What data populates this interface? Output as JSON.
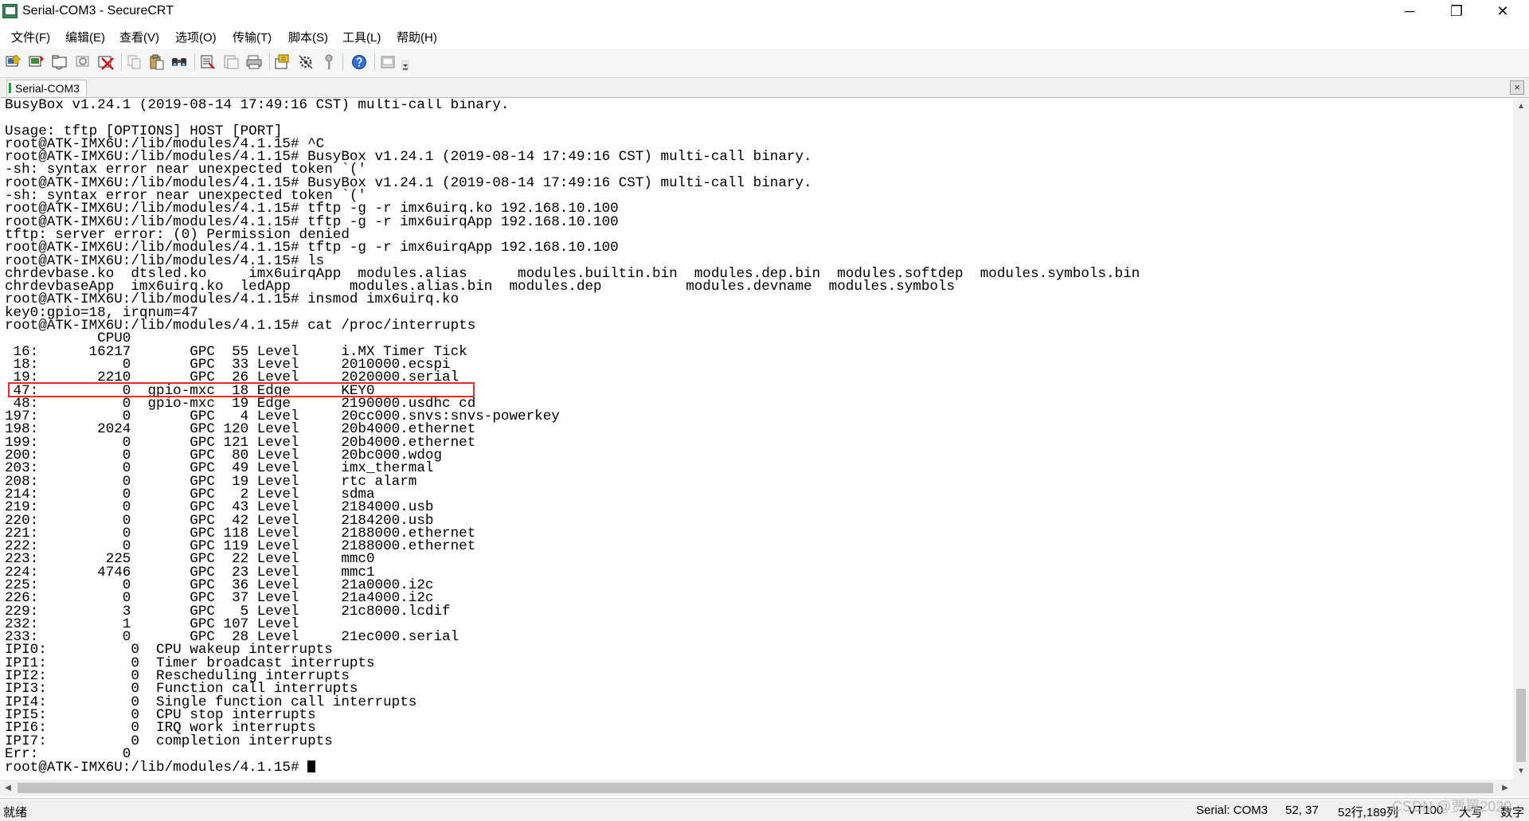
{
  "window": {
    "title": "Serial-COM3 - SecureCRT",
    "minimize_glyph": "─",
    "restore_glyph": "❐",
    "close_glyph": "✕"
  },
  "menu": {
    "items": [
      {
        "label": "文件(F)"
      },
      {
        "label": "编辑(E)"
      },
      {
        "label": "查看(V)"
      },
      {
        "label": "选项(O)"
      },
      {
        "label": "传输(T)"
      },
      {
        "label": "脚本(S)"
      },
      {
        "label": "工具(L)"
      },
      {
        "label": "帮助(H)"
      }
    ]
  },
  "toolbar": {
    "icons": [
      "connect-icon",
      "quick-connect-icon",
      "connect-in-tab-icon",
      "reconnect-icon",
      "disconnect-icon",
      "copy-icon",
      "paste-icon",
      "find-icon",
      "print-icon",
      "print-setup-icon",
      "print-selection-icon",
      "session-options-icon",
      "global-options-icon",
      "keymap-icon",
      "help-icon",
      "sftp-icon",
      "toolbar-overflow-icon"
    ]
  },
  "tab": {
    "label": "Serial-COM3",
    "status_color": "#1aa33a",
    "close_glyph": "×"
  },
  "terminal": {
    "lines": [
      "BusyBox v1.24.1 (2019-08-14 17:49:16 CST) multi-call binary.",
      "",
      "Usage: tftp [OPTIONS] HOST [PORT]",
      "root@ATK-IMX6U:/lib/modules/4.1.15# ^C",
      "root@ATK-IMX6U:/lib/modules/4.1.15# BusyBox v1.24.1 (2019-08-14 17:49:16 CST) multi-call binary.",
      "-sh: syntax error near unexpected token `('",
      "root@ATK-IMX6U:/lib/modules/4.1.15# BusyBox v1.24.1 (2019-08-14 17:49:16 CST) multi-call binary.",
      "-sh: syntax error near unexpected token `('",
      "root@ATK-IMX6U:/lib/modules/4.1.15# tftp -g -r imx6uirq.ko 192.168.10.100",
      "root@ATK-IMX6U:/lib/modules/4.1.15# tftp -g -r imx6uirqApp 192.168.10.100",
      "tftp: server error: (0) Permission denied",
      "root@ATK-IMX6U:/lib/modules/4.1.15# tftp -g -r imx6uirqApp 192.168.10.100",
      "root@ATK-IMX6U:/lib/modules/4.1.15# ls",
      "chrdevbase.ko  dtsled.ko     imx6uirqApp  modules.alias      modules.builtin.bin  modules.dep.bin  modules.softdep  modules.symbols.bin",
      "chrdevbaseApp  imx6uirq.ko  ledApp       modules.alias.bin  modules.dep          modules.devname  modules.symbols",
      "root@ATK-IMX6U:/lib/modules/4.1.15# insmod imx6uirq.ko",
      "key0:gpio=18, irqnum=47",
      "root@ATK-IMX6U:/lib/modules/4.1.15# cat /proc/interrupts",
      "           CPU0",
      " 16:      16217       GPC  55 Level     i.MX Timer Tick",
      " 18:          0       GPC  33 Level     2010000.ecspi",
      " 19:       2210       GPC  26 Level     2020000.serial",
      " 47:          0  gpio-mxc  18 Edge      KEY0",
      " 48:          0  gpio-mxc  19 Edge      2190000.usdhc cd",
      "197:          0       GPC   4 Level     20cc000.snvs:snvs-powerkey",
      "198:       2024       GPC 120 Level     20b4000.ethernet",
      "199:          0       GPC 121 Level     20b4000.ethernet",
      "200:          0       GPC  80 Level     20bc000.wdog",
      "203:          0       GPC  49 Level     imx_thermal",
      "208:          0       GPC  19 Level     rtc alarm",
      "214:          0       GPC   2 Level     sdma",
      "219:          0       GPC  43 Level     2184000.usb",
      "220:          0       GPC  42 Level     2184200.usb",
      "221:          0       GPC 118 Level     2188000.ethernet",
      "222:          0       GPC 119 Level     2188000.ethernet",
      "223:        225       GPC  22 Level     mmc0",
      "224:       4746       GPC  23 Level     mmc1",
      "225:          0       GPC  36 Level     21a0000.i2c",
      "226:          0       GPC  37 Level     21a4000.i2c",
      "229:          3       GPC   5 Level     21c8000.lcdif",
      "232:          1       GPC 107 Level",
      "233:          0       GPC  28 Level     21ec000.serial",
      "IPI0:          0  CPU wakeup interrupts",
      "IPI1:          0  Timer broadcast interrupts",
      "IPI2:          0  Rescheduling interrupts",
      "IPI3:          0  Function call interrupts",
      "IPI4:          0  Single function call interrupts",
      "IPI5:          0  CPU stop interrupts",
      "IPI6:          0  IRQ work interrupts",
      "IPI7:          0  completion interrupts",
      "Err:          0"
    ],
    "prompt": "root@ATK-IMX6U:/lib/modules/4.1.15# ",
    "highlight_color": "#e32b2b"
  },
  "statusbar": {
    "ready": "就绪",
    "session": "Serial: COM3",
    "cursor_pos": "52,  37",
    "dims": "52行,189列",
    "terminal_type": "VT100",
    "caps": "大写",
    "num": "数字"
  },
  "watermark": "CSDN @贾翼2020"
}
